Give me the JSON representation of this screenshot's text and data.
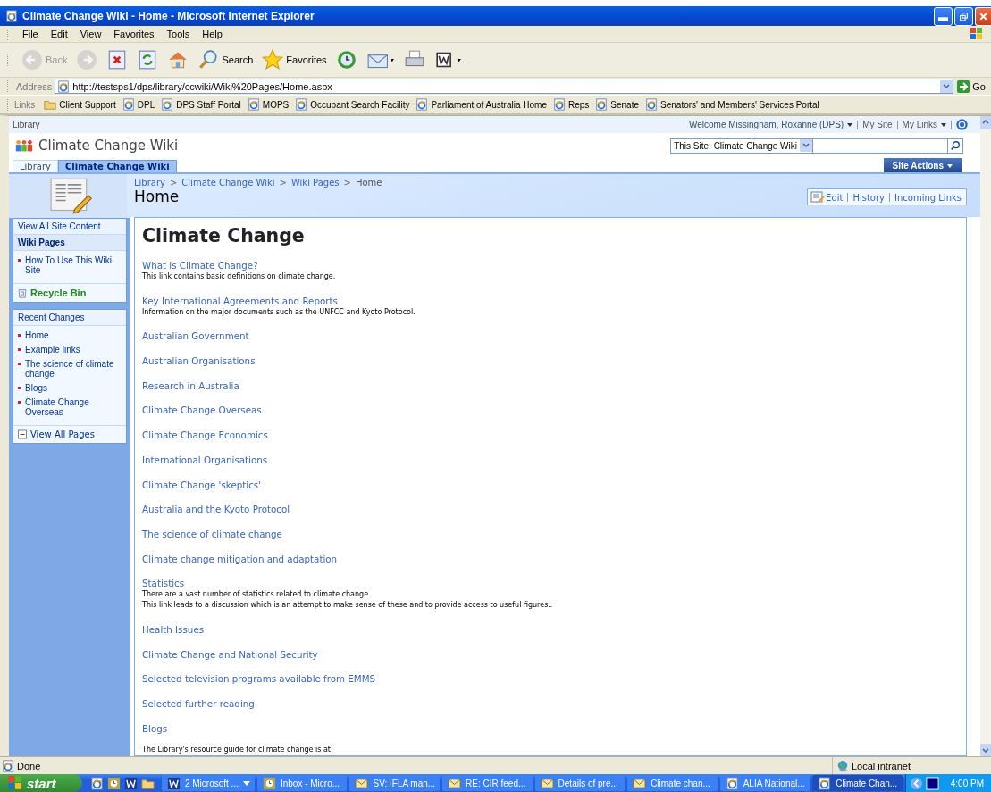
{
  "window": {
    "title": "Climate Change Wiki - Home - Microsoft Internet Explorer"
  },
  "menu": [
    "File",
    "Edit",
    "View",
    "Favorites",
    "Tools",
    "Help"
  ],
  "toolbar": [
    {
      "kind": "back",
      "label": "Back",
      "disabled": true
    },
    {
      "kind": "forward",
      "disabled": true
    },
    {
      "kind": "stop",
      "disabled": false
    },
    {
      "kind": "refresh",
      "disabled": false
    },
    {
      "kind": "home",
      "disabled": false
    },
    {
      "kind": "search",
      "label": "Search",
      "disabled": false
    },
    {
      "kind": "favorites",
      "label": "Favorites",
      "disabled": false
    },
    {
      "kind": "history",
      "disabled": false
    },
    {
      "kind": "mail",
      "disabled": false
    },
    {
      "kind": "print",
      "disabled": false
    },
    {
      "kind": "word",
      "disabled": false
    }
  ],
  "address": {
    "label": "Address",
    "value": "http://testsps1/dps/library/ccwiki/Wiki%20Pages/Home.aspx",
    "go": "Go"
  },
  "links": {
    "label": "Links",
    "items": [
      {
        "kind": "folder",
        "label": "Client Support"
      },
      {
        "kind": "page",
        "label": "DPL"
      },
      {
        "kind": "page",
        "label": "DPS Staff Portal"
      },
      {
        "kind": "page",
        "label": "MOPS"
      },
      {
        "kind": "page",
        "label": "Occupant Search Facility"
      },
      {
        "kind": "page",
        "label": "Parliament of Australia Home"
      },
      {
        "kind": "page",
        "label": "Reps"
      },
      {
        "kind": "page",
        "label": "Senate"
      },
      {
        "kind": "page",
        "label": "Senators' and Members' Services Portal"
      }
    ]
  },
  "site": {
    "top_link": "Library",
    "welcome": "Welcome Missingham, Roxanne (DPS)",
    "my_site": "My Site",
    "my_links": "My Links",
    "title": "Climate Change Wiki",
    "search_scope": "This Site: Climate Change Wiki",
    "tabs": [
      {
        "label": "Library",
        "selected": false
      },
      {
        "label": "Climate Change Wiki",
        "selected": true
      }
    ],
    "site_actions": "Site Actions"
  },
  "breadcrumb_separator": ">",
  "breadcrumb": [
    {
      "label": "Library",
      "link": true
    },
    {
      "label": "Climate Change Wiki",
      "link": true
    },
    {
      "label": "Wiki Pages",
      "link": true
    },
    {
      "label": "Home",
      "link": false
    }
  ],
  "page_title": "Home",
  "page_actions": [
    "Edit",
    "History",
    "Incoming Links"
  ],
  "nav": {
    "view_all": "View All Site Content",
    "section": "Wiki Pages",
    "section_items": [
      "How To Use This Wiki Site"
    ],
    "recycle": "Recycle Bin",
    "recent_title": "Recent Changes",
    "recent_items": [
      "Home",
      "Example links",
      "The science of climate change",
      "Blogs",
      "Climate Change Overseas"
    ],
    "view_all_pages": "View All Pages"
  },
  "content": {
    "heading": "Climate Change",
    "items": [
      {
        "title": "What is Climate Change?",
        "description": [
          "This link contains basic definitions on climate change."
        ]
      },
      {
        "title": "Key International Agreements and Reports",
        "description": [
          "Information on the major documents such as the UNFCC and Kyoto Protocol."
        ]
      },
      {
        "title": "Australian Government"
      },
      {
        "title": "Australian Organisations"
      },
      {
        "title": "Research in Australia"
      },
      {
        "title": "Climate Change Overseas"
      },
      {
        "title": "Climate Change Economics"
      },
      {
        "title": "International Organisations"
      },
      {
        "title": "Climate Change 'skeptics'"
      },
      {
        "title": "Australia and the Kyoto Protocol"
      },
      {
        "title": "The science of climate change"
      },
      {
        "title": "Climate change mitigation and adaptation"
      },
      {
        "title": "Statistics",
        "description": [
          "There are a vast number of statistics related to climate change.",
          "This link leads to a discussion which is an attempt to make sense of these and to provide access to useful figures.."
        ]
      },
      {
        "title": "Health Issues"
      },
      {
        "title": "Climate Change and National Security"
      },
      {
        "title": "Selected television programs available from EMMS"
      },
      {
        "title": "Selected further reading"
      },
      {
        "title": "Blogs"
      }
    ],
    "footer": "The Library's resource guide for climate change is at:"
  },
  "status_bar": {
    "text": "Done",
    "zone": "Local intranet"
  },
  "taskbar": {
    "start": "start",
    "tasks": [
      {
        "kind": "word",
        "label": "2 Microsoft ...",
        "grouped": true,
        "selected": false
      },
      {
        "kind": "calendar",
        "label": "Inbox - Micro...",
        "grouped": false,
        "selected": false
      },
      {
        "kind": "mail",
        "label": "SV: IFLA man...",
        "grouped": false,
        "selected": false
      },
      {
        "kind": "mail",
        "label": "RE: CIR feed...",
        "grouped": false,
        "selected": false
      },
      {
        "kind": "mail",
        "label": "Details of pre...",
        "grouped": false,
        "selected": false
      },
      {
        "kind": "mail",
        "label": "Climate chan...",
        "grouped": false,
        "selected": false
      },
      {
        "kind": "browser",
        "label": "ALIA National...",
        "grouped": false,
        "selected": false
      },
      {
        "kind": "browser",
        "label": "Climate Chan...",
        "grouped": false,
        "selected": true
      }
    ],
    "clock": "4:00 PM"
  }
}
